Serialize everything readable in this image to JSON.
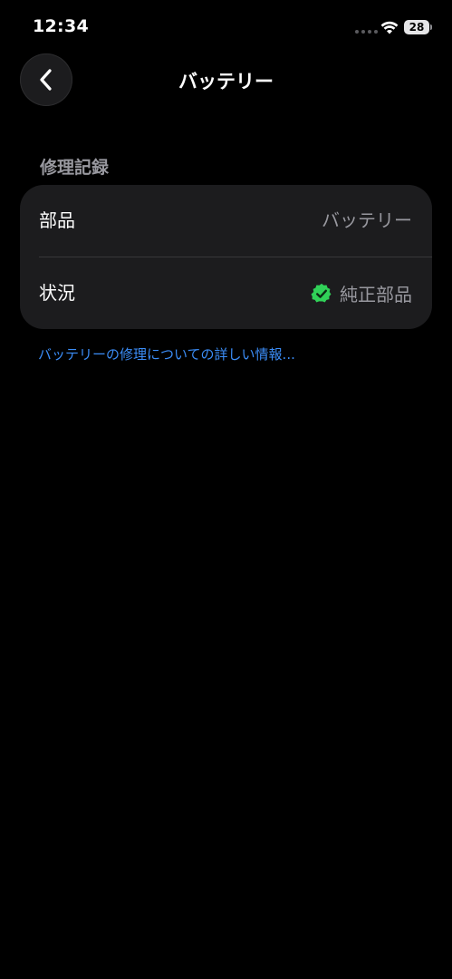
{
  "status_bar": {
    "time": "12:34",
    "battery_level": "28",
    "icons": [
      "signal-dots-icon",
      "wifi-icon",
      "battery-icon"
    ]
  },
  "nav": {
    "back_icon": "chevron-left-icon",
    "title": "バッテリー"
  },
  "section": {
    "header": "修理記録",
    "rows": [
      {
        "label": "部品",
        "value": "バッテリー"
      },
      {
        "label": "状況",
        "value": "純正部品",
        "icon": "verified-check-icon"
      }
    ]
  },
  "link": {
    "text": "バッテリーの修理についての詳しい情報..."
  },
  "colors": {
    "background": "#000000",
    "card": "#1c1c1e",
    "secondary_text": "#98989f",
    "link": "#3b8df7",
    "verified_green": "#30d158"
  }
}
